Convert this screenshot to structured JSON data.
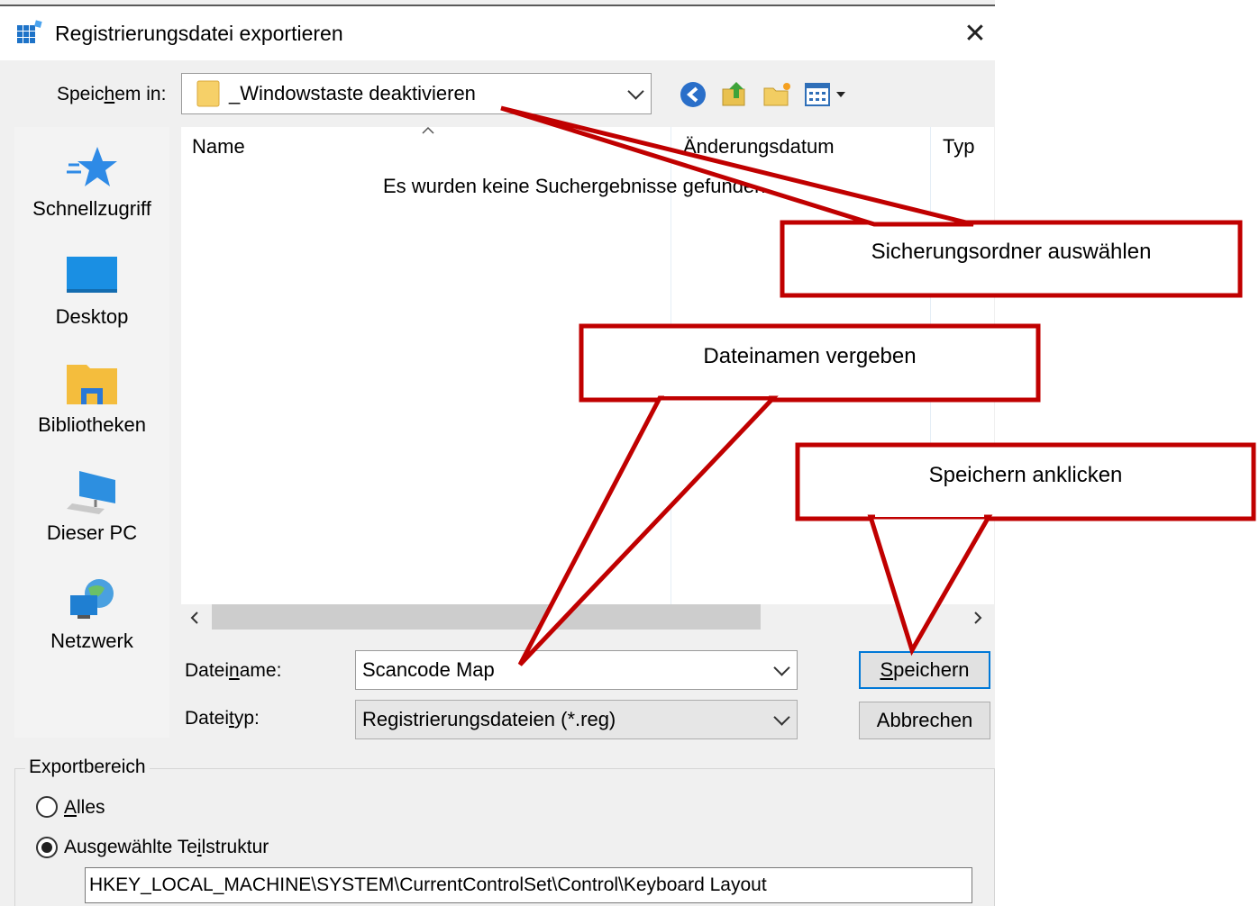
{
  "dialog": {
    "title": "Registrierungsdatei exportieren",
    "close_glyph": "✕"
  },
  "save_in": {
    "label_before": "Speic",
    "label_underlined": "h",
    "label_after": "em in:",
    "folder": "_Windowstaste deaktivieren",
    "folder_icon": "folder-icon"
  },
  "toolbar": {
    "icons": [
      "back-icon",
      "up-folder-icon",
      "new-folder-icon",
      "view-menu-icon"
    ]
  },
  "places": [
    {
      "label": "Schnellzugriff",
      "icon": "star-icon"
    },
    {
      "label": "Desktop",
      "icon": "desktop-icon"
    },
    {
      "label": "Bibliotheken",
      "icon": "libraries-icon"
    },
    {
      "label": "Dieser PC",
      "icon": "computer-icon"
    },
    {
      "label": "Netzwerk",
      "icon": "network-icon"
    }
  ],
  "file_list": {
    "columns": [
      "Name",
      "Änderungsdatum",
      "Typ"
    ],
    "empty_message": "Es wurden keine Suchergebnisse gefunden."
  },
  "filename": {
    "label_before": "Datei",
    "label_underlined": "n",
    "label_after": "ame:",
    "value": "Scancode Map"
  },
  "filetype": {
    "label_before": "Datei",
    "label_underlined": "t",
    "label_after": "yp:",
    "value": "Registrierungsdateien (*.reg)"
  },
  "buttons": {
    "save_underlined": "S",
    "save_rest": "peichern",
    "cancel": "Abbrechen"
  },
  "export_range": {
    "title": "Exportbereich",
    "all_underlined": "A",
    "all_rest": "lles",
    "selected_before": "Ausgewählte Te",
    "selected_underlined": "i",
    "selected_after": "lstruktur",
    "selected_option": "selected",
    "key_path": "HKEY_LOCAL_MACHINE\\SYSTEM\\CurrentControlSet\\Control\\Keyboard Layout"
  },
  "callouts": {
    "folder": "Sicherungsordner auswählen",
    "filename": "Dateinamen vergeben",
    "save": "Speichern anklicken",
    "color": "#c00000"
  }
}
